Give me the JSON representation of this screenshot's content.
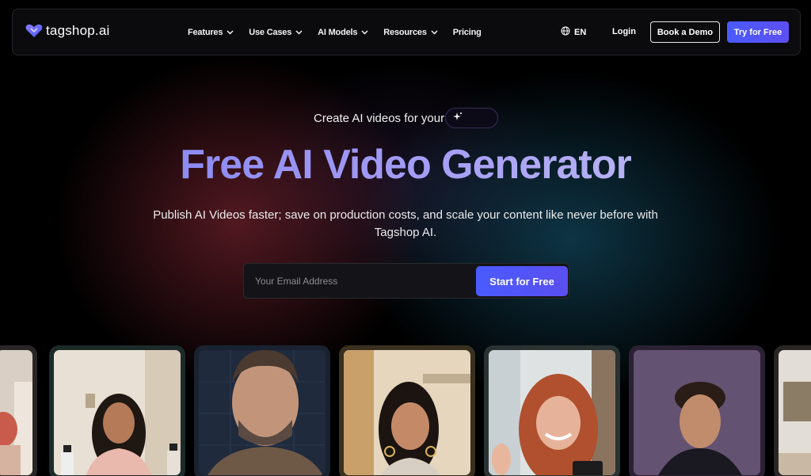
{
  "brand": {
    "name": "tagshop.ai"
  },
  "nav": {
    "items": [
      {
        "label": "Features",
        "dropdown": true
      },
      {
        "label": "Use Cases",
        "dropdown": true
      },
      {
        "label": "AI Models",
        "dropdown": true
      },
      {
        "label": "Resources",
        "dropdown": true
      },
      {
        "label": "Pricing",
        "dropdown": false
      }
    ],
    "language": "EN",
    "login": "Login",
    "demo_button": "Book a Demo",
    "try_button": "Try for Free"
  },
  "hero": {
    "kicker": "Create AI videos for your",
    "title": "Free AI Video Generator",
    "subtitle": "Publish AI Videos faster; save on production costs, and scale your content like never before with Tagshop AI."
  },
  "signup": {
    "email_placeholder": "Your Email Address",
    "email_value": "",
    "submit_label": "Start for Free"
  },
  "cards": [
    {
      "name": "video-card-partial-left",
      "subject": "woman-red-hair-partial"
    },
    {
      "name": "video-card-1",
      "subject": "woman-with-product-bottles"
    },
    {
      "name": "video-card-2",
      "subject": "bearded-man-talking"
    },
    {
      "name": "video-card-3",
      "subject": "woman-with-earrings"
    },
    {
      "name": "video-card-4",
      "subject": "smiling-woman-waving"
    },
    {
      "name": "video-card-5",
      "subject": "young-man-portrait"
    },
    {
      "name": "video-card-partial-right",
      "subject": "room-background-partial"
    }
  ],
  "colors": {
    "accent": "#4a5bff",
    "title_gradient_start": "#7b7ef2",
    "title_gradient_end": "#c7c3f3",
    "background": "#000000"
  }
}
